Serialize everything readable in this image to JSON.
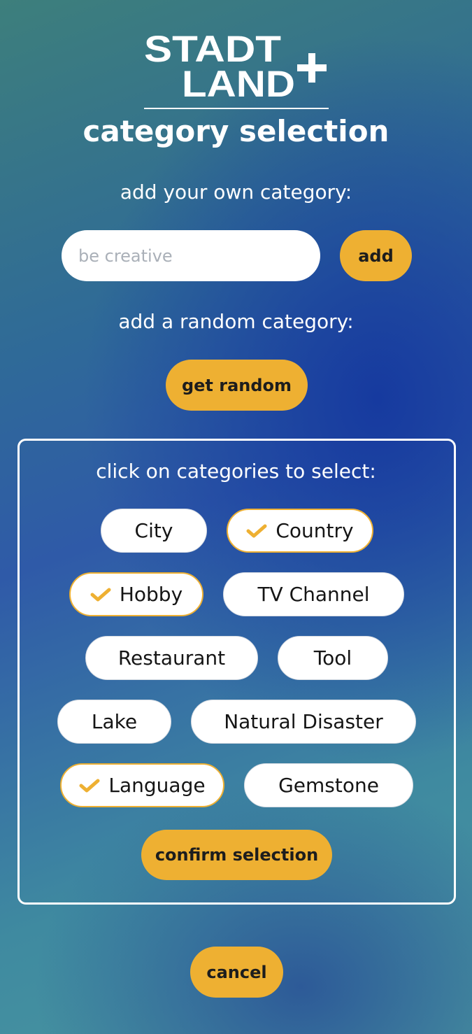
{
  "logo": {
    "line1": "STADT",
    "line2": "LAND",
    "plus": "+"
  },
  "title": "category selection",
  "own_category": {
    "label": "add your own category:",
    "placeholder": "be creative",
    "value": "",
    "add_label": "add"
  },
  "random_category": {
    "label": "add a random category:",
    "button_label": "get random"
  },
  "selection": {
    "label": "click on categories to select:",
    "categories": [
      {
        "name": "City",
        "selected": false
      },
      {
        "name": "Country",
        "selected": true
      },
      {
        "name": "Hobby",
        "selected": true
      },
      {
        "name": "TV Channel",
        "selected": false
      },
      {
        "name": "Restaurant",
        "selected": false
      },
      {
        "name": "Tool",
        "selected": false
      },
      {
        "name": "Lake",
        "selected": false
      },
      {
        "name": "Natural Disaster",
        "selected": false
      },
      {
        "name": "Language",
        "selected": true
      },
      {
        "name": "Gemstone",
        "selected": false
      }
    ],
    "confirm_label": "confirm selection"
  },
  "cancel_label": "cancel",
  "colors": {
    "accent": "#eeb032",
    "chip_bg": "#ffffff",
    "text_dark": "#151515"
  },
  "icons": {
    "selected": "checkmark-icon"
  }
}
